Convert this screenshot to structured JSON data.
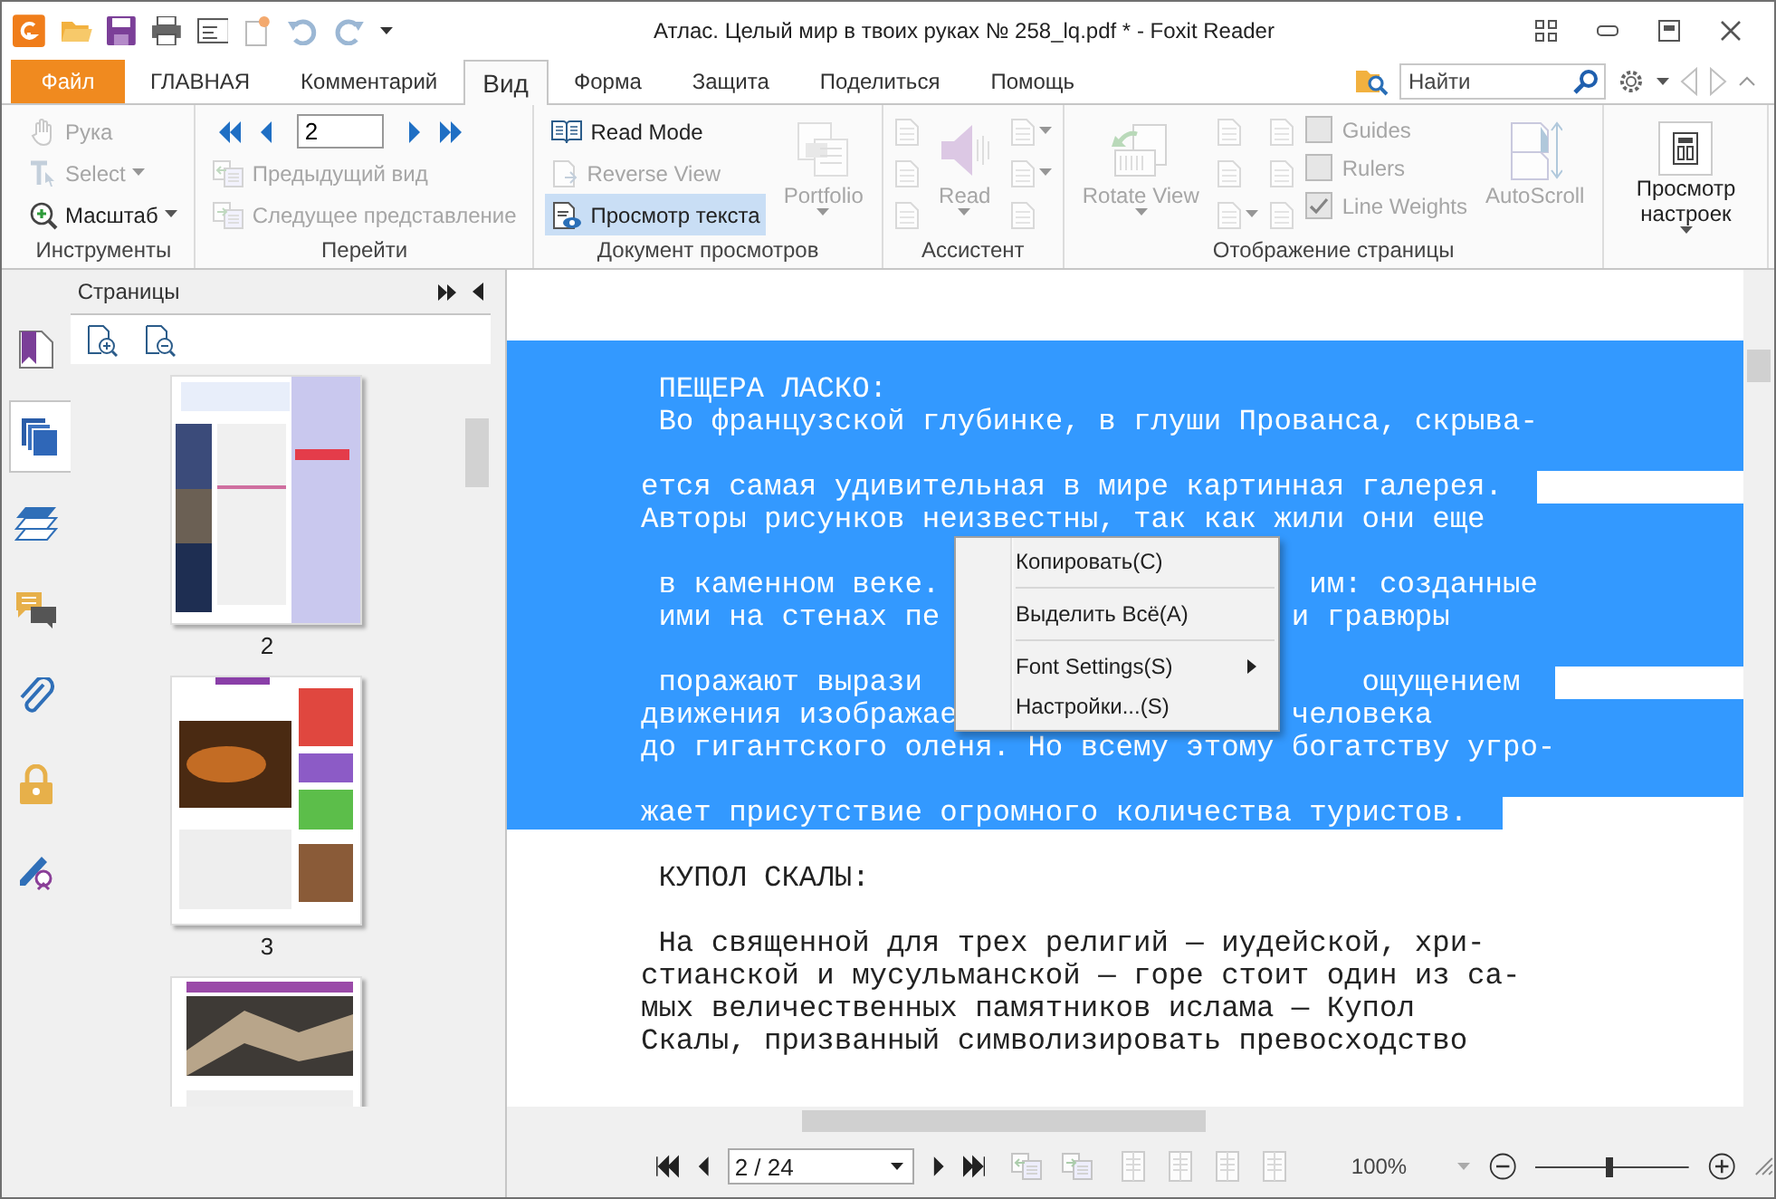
{
  "window": {
    "title": "Атлас. Целый мир в твоих руках № 258_lq.pdf * - Foxit Reader"
  },
  "tabs": [
    {
      "label": "Файл",
      "kind": "file"
    },
    {
      "label": "ГЛАВНАЯ",
      "kind": "tab",
      "selected": false
    },
    {
      "label": "Комментарий",
      "kind": "tab",
      "selected": false
    },
    {
      "label": "Вид",
      "kind": "tab",
      "selected": true
    },
    {
      "label": "Форма",
      "kind": "tab",
      "selected": false
    },
    {
      "label": "Защита",
      "kind": "tab",
      "selected": false
    },
    {
      "label": "Поделиться",
      "kind": "tab",
      "selected": false
    },
    {
      "label": "Помощь",
      "kind": "tab",
      "selected": false
    }
  ],
  "search": {
    "placeholder": "Найти"
  },
  "ribbon": {
    "groups": [
      {
        "label": "Инструменты",
        "columns": [
          [
            {
              "kind": "small",
              "label": "Рука",
              "disabled": true
            },
            {
              "kind": "small",
              "label": "Select",
              "disabled": true,
              "dropdown": true
            },
            {
              "kind": "small",
              "label": "Масштаб",
              "disabled": false,
              "dropdown": true
            }
          ]
        ]
      },
      {
        "label": "Перейти",
        "columns": [
          [
            {
              "kind": "pager",
              "value": "2"
            },
            {
              "kind": "small",
              "label": "Предыдущий вид",
              "disabled": true
            },
            {
              "kind": "small",
              "label": "Следущее представление",
              "disabled": true
            }
          ]
        ]
      },
      {
        "label": "Документ просмотров",
        "columns": [
          [
            {
              "kind": "small",
              "label": "Read Mode",
              "disabled": false
            },
            {
              "kind": "small",
              "label": "Reverse View",
              "disabled": true
            },
            {
              "kind": "small",
              "label": "Просмотр текста",
              "disabled": false,
              "selected": true
            }
          ],
          [
            {
              "kind": "large",
              "label": "Portfolio",
              "disabled": true,
              "dropdown": true
            }
          ]
        ]
      },
      {
        "label": "Ассистент",
        "columns": [
          [
            {
              "kind": "icon",
              "disabled": true
            },
            {
              "kind": "icon",
              "disabled": true
            },
            {
              "kind": "icon",
              "disabled": true
            }
          ],
          [
            {
              "kind": "large",
              "label": "Read",
              "disabled": true,
              "dropdown": true
            }
          ],
          [
            {
              "kind": "icon",
              "disabled": true,
              "dropdown": true
            },
            {
              "kind": "icon",
              "disabled": true,
              "dropdown": true
            },
            {
              "kind": "icon",
              "disabled": true
            }
          ]
        ]
      },
      {
        "label": "Отображение страницы",
        "columns": [
          [
            {
              "kind": "large",
              "label": "Rotate View",
              "disabled": true,
              "dropdown": true
            }
          ],
          [
            {
              "kind": "icon",
              "disabled": true
            },
            {
              "kind": "icon",
              "disabled": true
            },
            {
              "kind": "icon",
              "disabled": true,
              "dropdown": true
            }
          ],
          [
            {
              "kind": "icon",
              "disabled": true
            },
            {
              "kind": "icon",
              "disabled": true
            },
            {
              "kind": "icon",
              "disabled": true
            }
          ],
          [
            {
              "kind": "checkbox",
              "label": "Guides",
              "disabled": true,
              "checked": false
            },
            {
              "kind": "checkbox",
              "label": "Rulers",
              "disabled": true,
              "checked": false
            },
            {
              "kind": "checkbox",
              "label": "Line Weights",
              "disabled": true,
              "checked": true
            }
          ],
          [
            {
              "kind": "large",
              "label": "AutoScroll",
              "disabled": true
            }
          ]
        ]
      },
      {
        "columns": [
          [
            {
              "kind": "large",
              "label": "Просмотр настроек",
              "disabled": false,
              "dropdown": true
            }
          ]
        ]
      }
    ]
  },
  "side_panel": {
    "title": "Страницы",
    "nav": [
      {
        "kind": "bookmarks",
        "selected": false
      },
      {
        "kind": "pages",
        "selected": true
      },
      {
        "kind": "layers",
        "selected": false
      },
      {
        "kind": "comments",
        "selected": false
      },
      {
        "kind": "attachments",
        "selected": false
      },
      {
        "kind": "security",
        "selected": false
      },
      {
        "kind": "signatures",
        "selected": false
      }
    ],
    "thumbnails": [
      {
        "kind": "picture",
        "label": "2"
      },
      {
        "kind": "picture",
        "label": "3"
      },
      {
        "kind": "picture"
      }
    ]
  },
  "document": {
    "lines": [
      {
        "kind": "blank",
        "selected": true
      },
      {
        "kind": "text",
        "text": " ПЕЩЕРА ЛАСКО:",
        "selected": true
      },
      {
        "kind": "text",
        "text": " Во французской глубинке, в глуши Прованса, скрыва-",
        "selected": true
      },
      {
        "kind": "blank",
        "selected": true
      },
      {
        "kind": "text",
        "text": "ется самая удивительная в мире картинная галерея.",
        "selected": true,
        "selection_ends": true
      },
      {
        "kind": "text",
        "text": "Авторы рисунков неизвестны, так как жили они еще",
        "selected": true
      },
      {
        "kind": "blank",
        "selected": true
      },
      {
        "kind": "text",
        "text": " в каменном веке.",
        "tail": "им: созданные",
        "selected": true
      },
      {
        "kind": "text",
        "text": " ими на стенах пе",
        "tail": "и гравюры",
        "selected": true
      },
      {
        "kind": "blank",
        "selected": true
      },
      {
        "kind": "text",
        "text": " поражают вырази",
        "tail": "ощущением",
        "selected": true,
        "selection_ends": true
      },
      {
        "kind": "text",
        "text": "движения изображае",
        "tail": "человека",
        "selected": true
      },
      {
        "kind": "text",
        "text": "до гигантского оленя. Но всему этому богатству угро-",
        "selected": true
      },
      {
        "kind": "blank",
        "selected": true
      },
      {
        "kind": "text",
        "text": "жает присутствие огромного количества туристов.",
        "selected": true,
        "selection_ends": true
      },
      {
        "kind": "blank",
        "selected": false
      },
      {
        "kind": "text",
        "text": " КУПОЛ СКАЛЫ:",
        "selected": false
      },
      {
        "kind": "blank",
        "selected": false
      },
      {
        "kind": "text",
        "text": " На священной для трех религий — иудейской, хри-",
        "selected": false
      },
      {
        "kind": "text",
        "text": "стианской и мусульманской — горе стоит один из са-",
        "selected": false
      },
      {
        "kind": "text",
        "text": "мых величественных памятников ислама — Купол",
        "selected": false
      },
      {
        "kind": "text",
        "text": "Скалы, призванный символизировать превосходство",
        "selected": false
      }
    ]
  },
  "context_menu": {
    "items": [
      {
        "kind": "item",
        "label": "Копировать(C)",
        "submenu": false
      },
      {
        "kind": "separator"
      },
      {
        "kind": "item",
        "label": "Выделить Всё(A)",
        "submenu": false
      },
      {
        "kind": "separator"
      },
      {
        "kind": "item",
        "label": "Font Settings(S)",
        "submenu": true
      },
      {
        "kind": "item",
        "label": "Настройки...(S)",
        "submenu": false
      }
    ]
  },
  "status_bar": {
    "page_field": "2 / 24",
    "zoom": "100%",
    "zoom_slider": {
      "level": 0.48
    }
  }
}
